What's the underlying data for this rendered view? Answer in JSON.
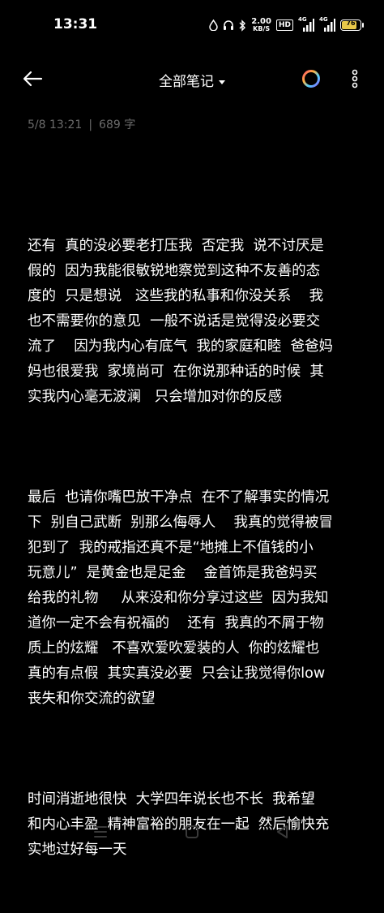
{
  "status_bar": {
    "time": "13:31",
    "net_speed_value": "2.00",
    "net_speed_unit": "KB/S",
    "hd_label": "HD",
    "signal1_label": "4G",
    "signal2_label": "4G",
    "battery_level": "76",
    "battery_color": "#e8c84a"
  },
  "toolbar": {
    "title": "全部笔记"
  },
  "note_meta": {
    "datetime": "5/8 13:21",
    "separator": "|",
    "word_count": "689 字"
  },
  "note": {
    "paragraphs": [
      "还有  真的没必要老打压我  否定我  说不讨厌是\n假的  因为我能很敏锐地察觉到这种不友善的态\n度的  只是想说   这些我的私事和你没关系    我\n也不需要你的意见  一般不说话是觉得没必要交\n流了    因为我内心有底气  我的家庭和睦  爸爸妈\n妈也很爱我  家境尚可  在你说那种话的时候  其\n实我内心毫无波澜   只会增加对你的反感",
      "最后  也请你嘴巴放干净点  在不了解事实的情况\n下  别自己武断  别那么侮辱人    我真的觉得被冒\n犯到了  我的戒指还真不是“地摊上不值钱的小\n玩意儿”  是黄金也是足金    金首饰是我爸妈买\n给我的礼物     从来没和你分享过这些  因为我知\n道你一定不会有祝福的    还有  我真的不屑于物\n质上的炫耀   不喜欢爱吹爱装的人  你的炫耀也\n真的有点假  其实真没必要  只会让我觉得你low\n丧失和你交流的欲望",
      "时间消逝地很快  大学四年说长也不长  我希望\n和内心丰盈  精神富裕的朋友在一起  然后愉快充\n实地过好每一天"
    ]
  },
  "colors": {
    "background": "#000000",
    "text": "#ffffff",
    "meta_text": "#6b6b6b",
    "nav_icon": "#3a3a3a"
  },
  "icons": {
    "back": "arrow-left-icon",
    "ring": "color-ring-icon",
    "more": "vertical-dots-icon",
    "nav_menu": "menu-lines-icon",
    "nav_home": "square-home-icon",
    "nav_back": "triangle-back-icon"
  }
}
